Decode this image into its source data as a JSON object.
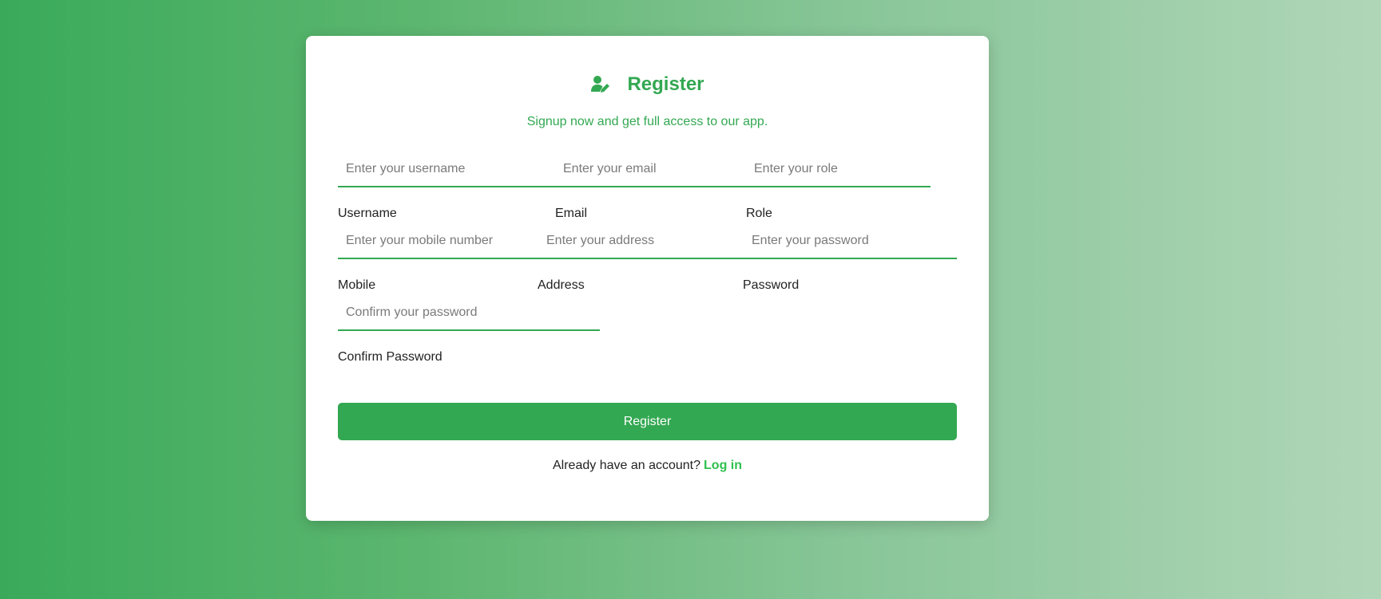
{
  "header": {
    "icon": "user-edit-icon",
    "title": "Register",
    "subtitle": "Signup now and get full access to our app."
  },
  "form": {
    "username": {
      "placeholder": "Enter your username",
      "label": "Username",
      "value": ""
    },
    "email": {
      "placeholder": "Enter your email",
      "label": "Email",
      "value": ""
    },
    "role": {
      "placeholder": "Enter your role",
      "label": "Role",
      "value": ""
    },
    "mobile": {
      "placeholder": "Enter your mobile number",
      "label": "Mobile",
      "value": ""
    },
    "address": {
      "placeholder": "Enter your address",
      "label": "Address",
      "value": ""
    },
    "password": {
      "placeholder": "Enter your password",
      "label": "Password",
      "value": ""
    },
    "confirm_password": {
      "placeholder": "Confirm your password",
      "label": "Confirm Password",
      "value": ""
    }
  },
  "submit_label": "Register",
  "footer": {
    "text": "Already have an account?",
    "link_label": "Log in"
  },
  "colors": {
    "accent": "#33a852",
    "link": "#2ec14e",
    "card": "#ffffff"
  }
}
